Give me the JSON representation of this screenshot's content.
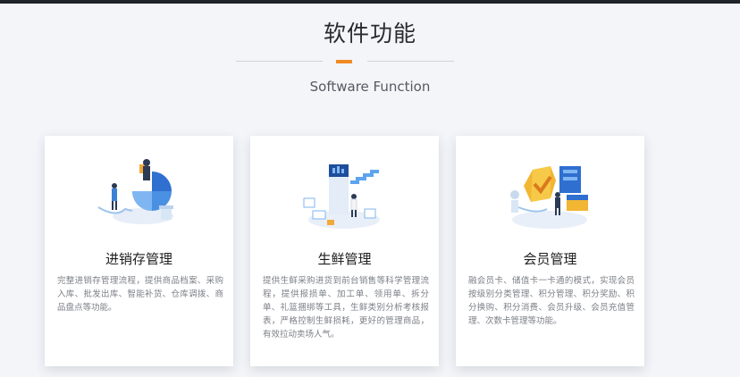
{
  "section": {
    "title": "软件功能",
    "subtitle": "Software Function",
    "accent_color": "#f08a24"
  },
  "cards": [
    {
      "title": "进销存管理",
      "description": "完整进销存管理流程，提供商品档案、采购入库、批发出库、智能补货、仓库调拨、商品盘点等功能。",
      "icon": "inventory-illustration"
    },
    {
      "title": "生鲜管理",
      "description": "提供生鲜采购进货到前台销售等科学管理流程，提供报损单、加工单、领用单、拆分单、礼篮捆绑等工具，生鲜类别分析考核报表，严格控制生鲜损耗，更好的管理商品，有效拉动卖场人气。",
      "icon": "fresh-produce-illustration"
    },
    {
      "title": "会员管理",
      "description": "融会员卡、储值卡一卡通的模式，实现会员按级别分类管理、积分管理、积分奖励、积分换购、积分消费、会员升级、会员充值管理、次数卡管理等功能。",
      "icon": "membership-illustration"
    }
  ]
}
